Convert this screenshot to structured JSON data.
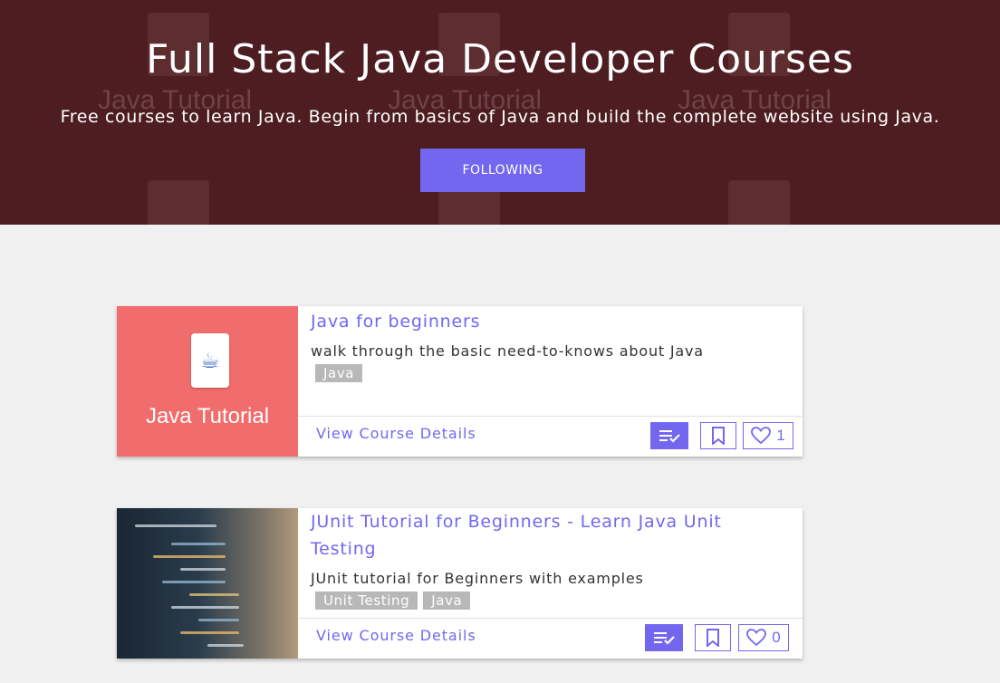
{
  "hero": {
    "title": "Full Stack Java Developer Courses",
    "subtitle": "Free courses to learn Java. Begin from basics of Java and build the complete website using Java.",
    "follow_label": "FOLLOWING",
    "watermark_text": "Java Tutorial",
    "background_color": "#4e1d21"
  },
  "accent_color": "#7367f0",
  "courses": [
    {
      "title": "Java for beginners",
      "description": "walk through the basic need-to-knows about Java",
      "tags": [
        "Java"
      ],
      "thumbnail_caption": "Java Tutorial",
      "details_label": "View Course Details",
      "like_count": "1",
      "icons": [
        "playlist-check-icon",
        "bookmark-icon",
        "heart-icon"
      ]
    },
    {
      "title": "JUnit Tutorial for Beginners - Learn Java Unit Testing",
      "description": "JUnit tutorial for Beginners with examples",
      "tags": [
        "Unit Testing",
        "Java"
      ],
      "details_label": "View Course Details",
      "like_count": "0",
      "icons": [
        "playlist-check-icon",
        "bookmark-icon",
        "heart-icon"
      ]
    }
  ]
}
